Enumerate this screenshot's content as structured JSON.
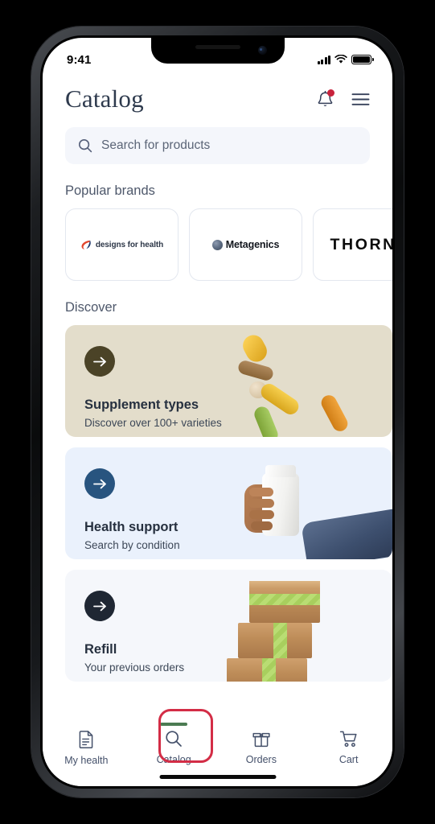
{
  "status_bar": {
    "time": "9:41",
    "cellular_icon": "signal-bars-icon",
    "wifi_icon": "wifi-icon",
    "battery_icon": "battery-full-icon"
  },
  "header": {
    "title": "Catalog",
    "notifications_icon": "bell-icon",
    "notification_badge": true,
    "menu_icon": "hamburger-menu-icon"
  },
  "search": {
    "icon": "search-icon",
    "placeholder": "Search for products",
    "value": ""
  },
  "popular_brands": {
    "title": "Popular brands",
    "cards": [
      {
        "name": "designs for health",
        "logo_icon": "designs-for-health-logo"
      },
      {
        "name": "Metagenics",
        "logo_icon": "metagenics-logo"
      },
      {
        "name": "THORNE",
        "logo_icon": "thorne-logo"
      }
    ]
  },
  "discover": {
    "title": "Discover",
    "cards": [
      {
        "heading": "Supplement types",
        "subtitle": "Discover over 100+ varieties",
        "arrow_icon": "arrow-right-icon",
        "bg_color": "#e3ddcb",
        "arrow_bg": "#4b4327",
        "art": "pills-illustration"
      },
      {
        "heading": "Health support",
        "subtitle": "Search by condition",
        "arrow_icon": "arrow-right-icon",
        "bg_color": "#eaf1fc",
        "arrow_bg": "#28547f",
        "art": "hand-holding-bottle-illustration"
      },
      {
        "heading": "Refill",
        "subtitle": "Your previous orders",
        "arrow_icon": "arrow-right-icon",
        "bg_color": "#f5f7fb",
        "arrow_bg": "#1f2733",
        "art": "stacked-boxes-illustration"
      }
    ]
  },
  "bottom_nav": {
    "active_index": 1,
    "active_indicator_color": "#4b7b52",
    "highlight_color": "#d32d46",
    "items": [
      {
        "label": "My health",
        "icon": "document-icon"
      },
      {
        "label": "Catalog",
        "icon": "search-icon"
      },
      {
        "label": "Orders",
        "icon": "open-box-icon"
      },
      {
        "label": "Cart",
        "icon": "shopping-cart-icon"
      }
    ]
  }
}
